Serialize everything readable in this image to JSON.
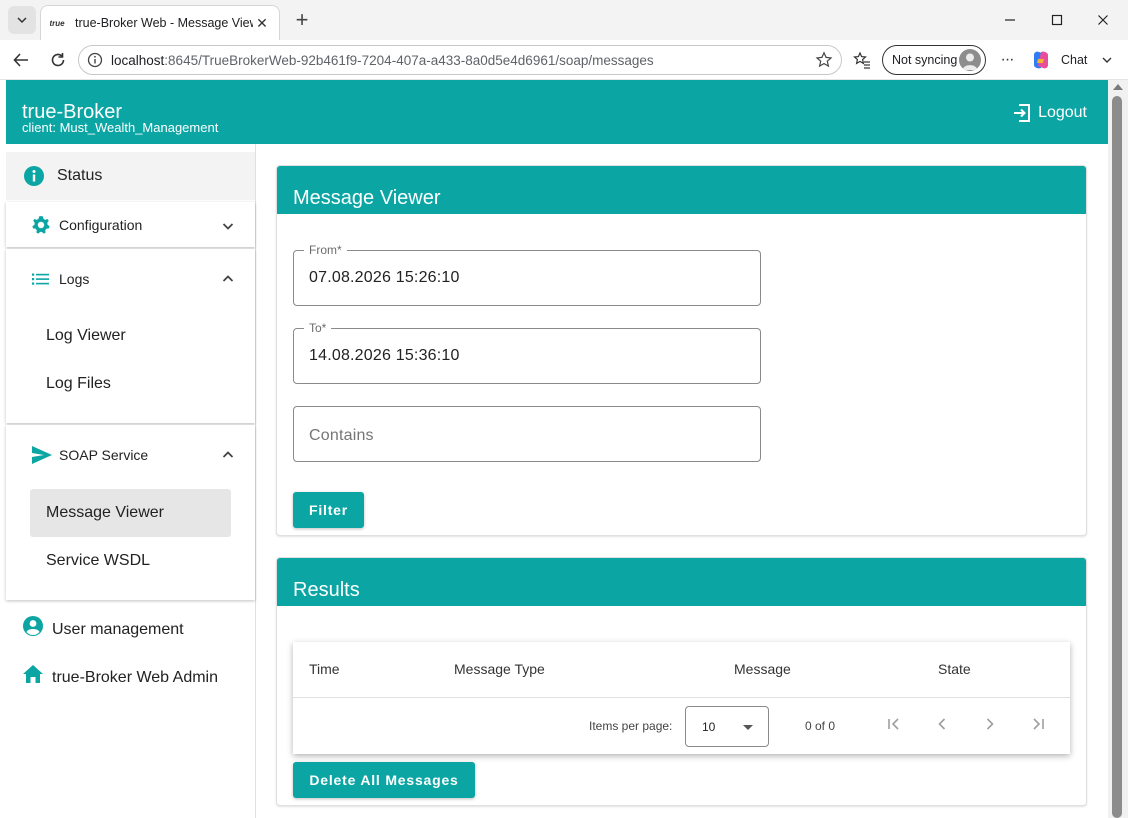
{
  "browser": {
    "tab_title": "true-Broker Web - Message Viewer",
    "favicon_text": "true",
    "url_host": "localhost",
    "url_rest": ":8645/TrueBrokerWeb-92b461f9-7204-407a-a433-8a0d5e4d6961/soap/messages",
    "sync_label": "Not syncing",
    "chat_label": "Chat",
    "more_label": "···"
  },
  "header": {
    "title": "true-Broker",
    "client": "client: Must_Wealth_Management",
    "logout_label": "Logout"
  },
  "sidebar": {
    "status_label": "Status",
    "configuration_label": "Configuration",
    "logs_label": "Logs",
    "logs_items": [
      "Log Viewer",
      "Log Files"
    ],
    "soap_label": "SOAP Service",
    "soap_items": [
      "Message Viewer",
      "Service WSDL"
    ],
    "user_management_label": "User management",
    "admin_label": "true-Broker Web Admin"
  },
  "viewer": {
    "title": "Message Viewer",
    "from_label": "From*",
    "from_value": "07.08.2026 15:26:10",
    "to_label": "To*",
    "to_value": "14.08.2026 15:36:10",
    "contains_placeholder": "Contains",
    "filter_label": "Filter"
  },
  "results": {
    "title": "Results",
    "columns": [
      "Time",
      "Message Type",
      "Message",
      "State"
    ],
    "items_per_page_label": "Items per page:",
    "items_per_page_value": "10",
    "range_label": "0 of 0",
    "delete_all_label": "Delete All Messages"
  },
  "colors": {
    "accent": "#0ba6a4"
  }
}
